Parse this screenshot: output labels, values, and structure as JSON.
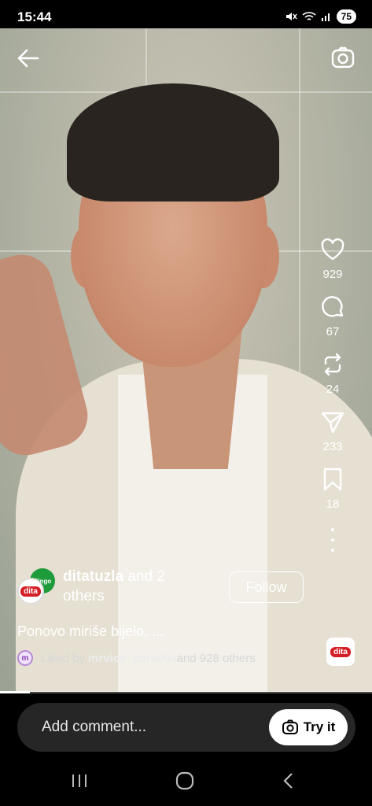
{
  "status_bar": {
    "time": "15:44",
    "battery": "75",
    "icons": [
      "mute-icon",
      "wifi-icon",
      "signal-icon"
    ]
  },
  "top_controls": {
    "back_icon": "arrow-left-icon",
    "camera_icon": "camera-icon"
  },
  "actions": [
    {
      "name": "like",
      "icon": "heart-icon",
      "count": "929"
    },
    {
      "name": "comment",
      "icon": "comment-icon",
      "count": "67"
    },
    {
      "name": "repost",
      "icon": "repost-icon",
      "count": "24"
    },
    {
      "name": "share",
      "icon": "send-icon",
      "count": "233"
    },
    {
      "name": "save",
      "icon": "bookmark-icon",
      "count": "18"
    }
  ],
  "author": {
    "username": "ditatuzla",
    "suffix": " and 2",
    "suffix2": "others",
    "avatar_a": "Bingo",
    "avatar_b": "dita",
    "follow_label": "Follow"
  },
  "caption": "Ponovo miriše bijelo. ...",
  "liked_by": {
    "prefix": "Liked by ",
    "user": "mrvice_zdravlja",
    "suffix": " and 928 others"
  },
  "audio_thumb": "dita",
  "progress": 0.08,
  "comment": {
    "placeholder": "Add comment...",
    "try_it": "Try it"
  },
  "colors": {
    "brand_red": "#d41f26",
    "brand_green": "#1e9b3a"
  }
}
